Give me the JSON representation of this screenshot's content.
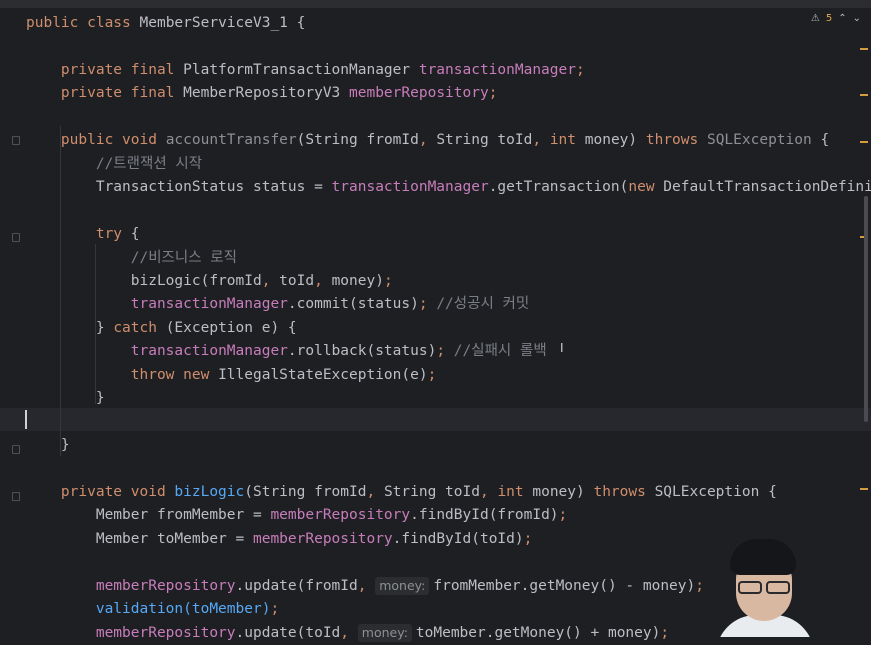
{
  "inspections": {
    "warning_count": "5"
  },
  "code_lines": [
    [
      {
        "t": "public class ",
        "c": "kw"
      },
      {
        "t": "MemberServiceV3_1 {",
        "c": ""
      }
    ],
    [],
    [
      {
        "t": "    private final ",
        "c": "kw"
      },
      {
        "t": "PlatformTransactionManager ",
        "c": ""
      },
      {
        "t": "transactionManager",
        "c": "fld"
      },
      {
        "t": ";",
        "c": "kw"
      }
    ],
    [
      {
        "t": "    private final ",
        "c": "kw"
      },
      {
        "t": "MemberRepositoryV3 ",
        "c": ""
      },
      {
        "t": "memberRepository",
        "c": "fld"
      },
      {
        "t": ";",
        "c": "kw"
      }
    ],
    [],
    [
      {
        "t": "    public void ",
        "c": "kw"
      },
      {
        "t": "accountTransfer",
        "c": "unused"
      },
      {
        "t": "(String fromId",
        "c": ""
      },
      {
        "t": ", ",
        "c": "kw"
      },
      {
        "t": "String toId",
        "c": ""
      },
      {
        "t": ", ",
        "c": "kw"
      },
      {
        "t": "int ",
        "c": "kw"
      },
      {
        "t": "money) ",
        "c": ""
      },
      {
        "t": "throws ",
        "c": "kw"
      },
      {
        "t": "SQLException",
        "c": "unused"
      },
      {
        "t": " {",
        "c": ""
      }
    ],
    [
      {
        "t": "        //트랜잭션 시작",
        "c": "cmt"
      }
    ],
    [
      {
        "t": "        TransactionStatus status = ",
        "c": ""
      },
      {
        "t": "transactionManager",
        "c": "fld"
      },
      {
        "t": ".getTransaction(",
        "c": ""
      },
      {
        "t": "new ",
        "c": "kw"
      },
      {
        "t": "DefaultTransactionDefinit",
        "c": ""
      }
    ],
    [],
    [
      {
        "t": "        try ",
        "c": "kw"
      },
      {
        "t": "{",
        "c": ""
      }
    ],
    [
      {
        "t": "            //비즈니스 로직",
        "c": "cmt"
      }
    ],
    [
      {
        "t": "            bizLogic(fromId",
        "c": ""
      },
      {
        "t": ", ",
        "c": "kw"
      },
      {
        "t": "toId",
        "c": ""
      },
      {
        "t": ", ",
        "c": "kw"
      },
      {
        "t": "money)",
        "c": ""
      },
      {
        "t": ";",
        "c": "kw"
      }
    ],
    [
      {
        "t": "            ",
        "c": ""
      },
      {
        "t": "transactionManager",
        "c": "fld"
      },
      {
        "t": ".commit(status)",
        "c": ""
      },
      {
        "t": "; ",
        "c": "kw"
      },
      {
        "t": "//성공시 커밋",
        "c": "cmt"
      }
    ],
    [
      {
        "t": "        } ",
        "c": ""
      },
      {
        "t": "catch ",
        "c": "kw"
      },
      {
        "t": "(Exception e) {",
        "c": ""
      }
    ],
    [
      {
        "t": "            ",
        "c": ""
      },
      {
        "t": "transactionManager",
        "c": "fld"
      },
      {
        "t": ".rollback(status)",
        "c": ""
      },
      {
        "t": "; ",
        "c": "kw"
      },
      {
        "t": "//실패시 롤백",
        "c": "cmt"
      }
    ],
    [
      {
        "t": "            throw new ",
        "c": "kw"
      },
      {
        "t": "IllegalStateException(e)",
        "c": ""
      },
      {
        "t": ";",
        "c": "kw"
      }
    ],
    [
      {
        "t": "        }",
        "c": ""
      }
    ],
    [],
    [
      {
        "t": "    }",
        "c": ""
      }
    ],
    [],
    [
      {
        "t": "    private void ",
        "c": "kw"
      },
      {
        "t": "bizLogic",
        "c": "fn"
      },
      {
        "t": "(String fromId",
        "c": ""
      },
      {
        "t": ", ",
        "c": "kw"
      },
      {
        "t": "String toId",
        "c": ""
      },
      {
        "t": ", ",
        "c": "kw"
      },
      {
        "t": "int ",
        "c": "kw"
      },
      {
        "t": "money) ",
        "c": ""
      },
      {
        "t": "throws ",
        "c": "kw"
      },
      {
        "t": "SQLException {",
        "c": ""
      }
    ],
    [
      {
        "t": "        Member fromMember = ",
        "c": ""
      },
      {
        "t": "memberRepository",
        "c": "fld"
      },
      {
        "t": ".findById(fromId)",
        "c": ""
      },
      {
        "t": ";",
        "c": "kw"
      }
    ],
    [
      {
        "t": "        Member toMember = ",
        "c": ""
      },
      {
        "t": "memberRepository",
        "c": "fld"
      },
      {
        "t": ".findById(toId)",
        "c": ""
      },
      {
        "t": ";",
        "c": "kw"
      }
    ],
    [],
    [
      {
        "t": "        ",
        "c": ""
      },
      {
        "t": "memberRepository",
        "c": "fld"
      },
      {
        "t": ".update(fromId",
        "c": ""
      },
      {
        "t": ", ",
        "c": "kw"
      },
      {
        "t": "money:",
        "c": "hint"
      },
      {
        "t": "fromMember.getMoney() - money)",
        "c": ""
      },
      {
        "t": ";",
        "c": "kw"
      }
    ],
    [
      {
        "t": "        validation(toMember)",
        "c": "fn"
      },
      {
        "t": ";",
        "c": "kw"
      }
    ],
    [
      {
        "t": "        ",
        "c": ""
      },
      {
        "t": "memberRepository",
        "c": "fld"
      },
      {
        "t": ".update(toId",
        "c": ""
      },
      {
        "t": ", ",
        "c": "kw"
      },
      {
        "t": "money:",
        "c": "hint"
      },
      {
        "t": "toMember.getMoney() + money)",
        "c": ""
      },
      {
        "t": ";",
        "c": "kw"
      }
    ]
  ]
}
